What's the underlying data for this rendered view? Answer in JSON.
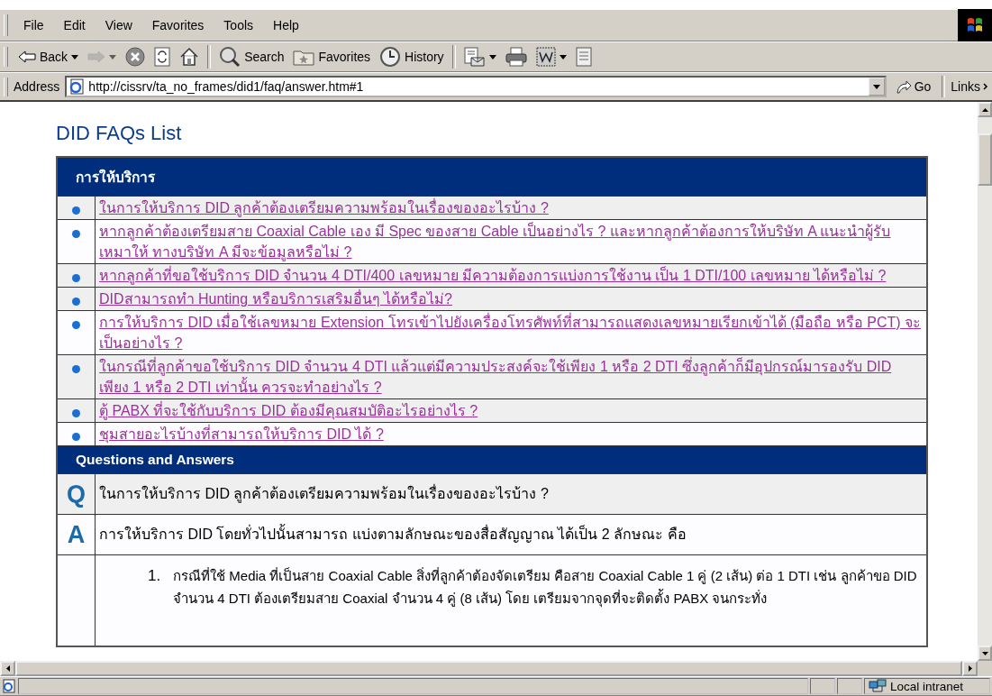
{
  "menu": [
    "File",
    "Edit",
    "View",
    "Favorites",
    "Tools",
    "Help"
  ],
  "toolbar": [
    {
      "kind": "back",
      "label": "Back",
      "disabled": false,
      "dropdown": true
    },
    {
      "kind": "forward",
      "disabled": true,
      "dropdown": true
    },
    {
      "kind": "stop",
      "disabled": false,
      "dropdown": false
    },
    {
      "kind": "refresh",
      "disabled": false,
      "dropdown": false
    },
    {
      "kind": "home",
      "disabled": false,
      "dropdown": false
    },
    {
      "kind": "separator"
    },
    {
      "kind": "search",
      "label": "Search",
      "disabled": false,
      "dropdown": false
    },
    {
      "kind": "favorites",
      "label": "Favorites",
      "disabled": false,
      "dropdown": false
    },
    {
      "kind": "history",
      "label": "History",
      "disabled": false,
      "dropdown": false
    },
    {
      "kind": "separator"
    },
    {
      "kind": "mail",
      "disabled": false,
      "dropdown": true
    },
    {
      "kind": "print",
      "disabled": false,
      "dropdown": false
    },
    {
      "kind": "edit",
      "disabled": false,
      "dropdown": true
    },
    {
      "kind": "discuss",
      "disabled": false,
      "dropdown": false
    }
  ],
  "address_bar": {
    "label": "Address",
    "value": "http://cissrv/ta_no_frames/did1/faq/answer.htm#1",
    "go": "Go",
    "links": "Links"
  },
  "page": {
    "title": "DID FAQs List",
    "faq_list": {
      "heading": "การให้บริการ",
      "items": [
        {
          "text": "ในการให้บริการ DID ลูกค้าต้องเตรียมความพร้อมในเรื่องของอะไรบ้าง ?",
          "shaded": true
        },
        {
          "text": "หากลูกค้าต้องเตรียมสาย Coaxial Cable เอง มี Spec ของสาย Cable เป็นอย่างไร ? และหากลูกค้าต้องการให้บริษัท A แนะนำผู้รับเหมาให้ ทางบริษัท A มีจะข้อมูลหรือไม่ ?",
          "shaded": false
        },
        {
          "text": "หากลูกค้าที่ขอใช้บริการ DID จำนวน 4 DTI/400 เลขหมาย มีความต้องการแบ่งการใช้งาน เป็น 1 DTI/100 เลขหมาย ได้หรือไม่ ?",
          "shaded": true
        },
        {
          "text": "DIDสามารถทำ Hunting หรือบริการเสริมอื่นๆ ได้หรือไม่?",
          "shaded": true
        },
        {
          "text": "การให้บริการ DID เมื่อใช้เลขหมาย Extension โทรเข้าไปยังเครื่องโทรศัพท์ที่สามารถแสดงเลขหมายเรียกเข้าได้ (มือถือ หรือ PCT) จะเป็นอย่างไร ?",
          "shaded": false
        },
        {
          "text": "ในกรณีที่ลูกค้าขอใช้บริการ DID จำนวน 4 DTI แล้วแต่มีความประสงค์จะใช้เพียง 1 หรือ 2 DTI ซึ่งลูกค้าก็มีอุปกรณ์มารองรับ DID เพียง 1 หรือ 2 DTI เท่านั้น ควรจะทำอย่างไร ?",
          "shaded": true
        },
        {
          "text": "ตู้ PABX ที่จะใช้กับบริการ DID ต้องมีคุณสมบัติอะไรอย่างไร ?",
          "shaded": true
        },
        {
          "text": "ชุมสายอะไรบ้างที่สามารถให้บริการ DID ได้ ?",
          "shaded": false
        }
      ]
    },
    "qa": {
      "heading": "Questions and Answers",
      "q_mark": "Q",
      "question": "ในการให้บริการ DID ลูกค้าต้องเตรียมความพร้อมในเรื่องของอะไรบ้าง ?",
      "a_mark": "A",
      "answer": "การให้บริการ DID โดยทั่วไปนั้นสามารถ แบ่งตามลักษณะของสื่อสัญญาณ ได้เป็น 2 ลักษณะ คือ",
      "points": [
        {
          "number": "1.",
          "text": "กรณีที่ใช้ Media ที่เป็นสาย Coaxial Cable สิ่งที่ลูกค้าต้องจัดเตรียม คือสาย Coaxial Cable 1 คู่ (2 เส้น) ต่อ 1 DTI เช่น ลูกค้าขอ DID จำนวน 4 DTI ต้องเตรียมสาย Coaxial จำนวน 4 คู่ (8 เส้น) โดย เตรียมจากจุดที่จะติดตั้ง PABX จนกระทั่ง"
        }
      ]
    }
  },
  "status_bar": {
    "zone": "Local intranet"
  }
}
